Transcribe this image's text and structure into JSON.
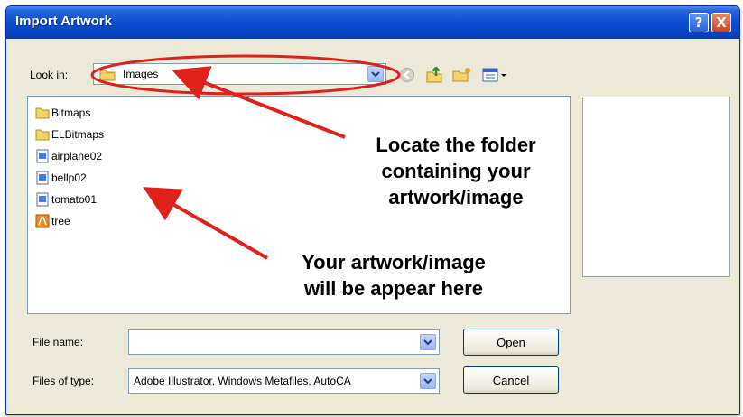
{
  "dialog": {
    "title": "Import Artwork",
    "help_label": "?",
    "close_label": "X"
  },
  "look_in": {
    "label": "Look in:",
    "value": "Images",
    "icon": "folder-icon"
  },
  "toolbar": {
    "icons": [
      "back-icon",
      "up-folder-icon",
      "new-folder-icon",
      "view-menu-icon"
    ]
  },
  "files": [
    {
      "name": "Bitmaps",
      "icon": "folder-icon"
    },
    {
      "name": "ELBitmaps",
      "icon": "folder-icon"
    },
    {
      "name": "airplane02",
      "icon": "image-file-icon"
    },
    {
      "name": "bellp02",
      "icon": "image-file-icon"
    },
    {
      "name": "tomato01",
      "icon": "image-file-icon"
    },
    {
      "name": "tree",
      "icon": "illustrator-file-icon"
    }
  ],
  "file_name": {
    "label": "File name:",
    "value": ""
  },
  "file_type": {
    "label": "Files of type:",
    "value": "Adobe Illustrator, Windows Metafiles, AutoCA"
  },
  "buttons": {
    "open": "Open",
    "cancel": "Cancel"
  },
  "annotations": {
    "folder_note_1": "Locate the folder",
    "folder_note_2": "containing your",
    "folder_note_3": "artwork/image",
    "list_note_1": "Your artwork/image",
    "list_note_2": "will be appear here"
  },
  "colors": {
    "annotation_red": "#e0201b",
    "titlebar_blue": "#0a4ed3",
    "dialog_bg": "#ece9d8"
  }
}
